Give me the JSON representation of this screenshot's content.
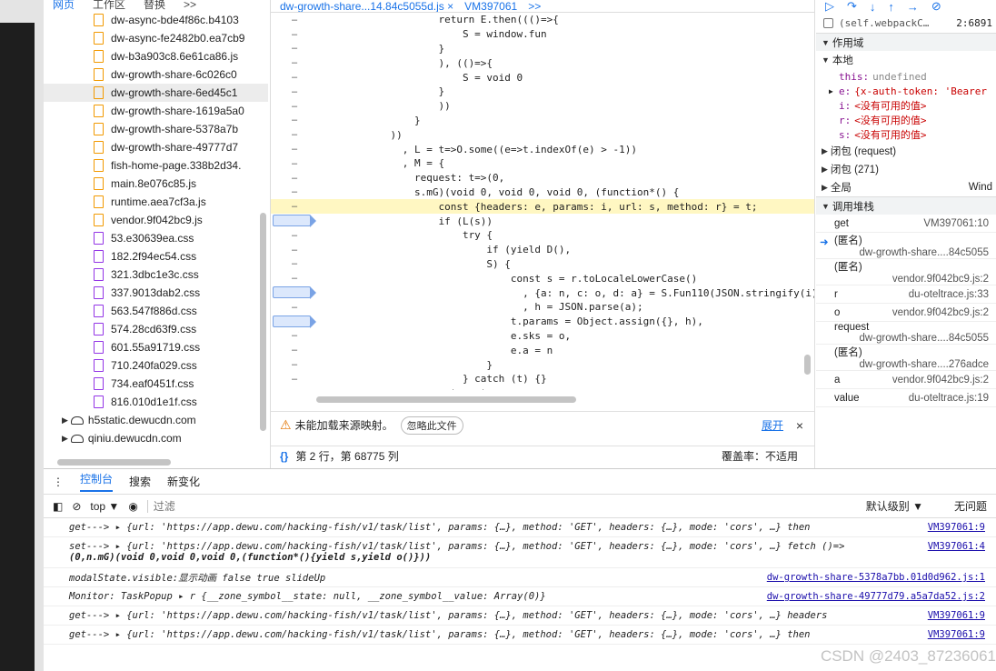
{
  "nav_tabs": [
    "网页",
    "工作区",
    "替换",
    ">>"
  ],
  "files": [
    {
      "name": "dw-async-bde4f86c.b4103",
      "type": "js"
    },
    {
      "name": "dw-async-fe2482b0.ea7cb9",
      "type": "js"
    },
    {
      "name": "dw-b3a903c8.6e61ca86.js",
      "type": "js"
    },
    {
      "name": "dw-growth-share-6c026c0",
      "type": "js"
    },
    {
      "name": "dw-growth-share-6ed45c1",
      "type": "js",
      "selected": true
    },
    {
      "name": "dw-growth-share-1619a5a0",
      "type": "js"
    },
    {
      "name": "dw-growth-share-5378a7b",
      "type": "js"
    },
    {
      "name": "dw-growth-share-49777d7",
      "type": "js"
    },
    {
      "name": "fish-home-page.338b2d34.",
      "type": "js"
    },
    {
      "name": "main.8e076c85.js",
      "type": "js"
    },
    {
      "name": "runtime.aea7cf3a.js",
      "type": "js"
    },
    {
      "name": "vendor.9f042bc9.js",
      "type": "js"
    },
    {
      "name": "53.e30639ea.css",
      "type": "css"
    },
    {
      "name": "182.2f94ec54.css",
      "type": "css"
    },
    {
      "name": "321.3dbc1e3c.css",
      "type": "css"
    },
    {
      "name": "337.9013dab2.css",
      "type": "css"
    },
    {
      "name": "563.547f886d.css",
      "type": "css"
    },
    {
      "name": "574.28cd63f9.css",
      "type": "css"
    },
    {
      "name": "601.55a91719.css",
      "type": "css"
    },
    {
      "name": "710.240fa029.css",
      "type": "css"
    },
    {
      "name": "734.eaf0451f.css",
      "type": "css"
    },
    {
      "name": "816.010d1e1f.css",
      "type": "css"
    }
  ],
  "domains": [
    "h5static.dewucdn.com",
    "qiniu.dewucdn.com"
  ],
  "editor": {
    "tab_label": "dw-growth-share...14.84c5055d.js",
    "tab_close": "×",
    "tab2": "VM397061",
    "more": ">>",
    "lines": [
      {
        "g": "–",
        "t": "                    return E.then((()=>{",
        "bp": false,
        "hl": false
      },
      {
        "g": "–",
        "t": "                        S = window.fun",
        "bp": false,
        "hl": false
      },
      {
        "g": "–",
        "t": "                    }",
        "bp": false,
        "hl": false
      },
      {
        "g": "–",
        "t": "                    ), (()=>{",
        "bp": false,
        "hl": false
      },
      {
        "g": "–",
        "t": "                        S = void 0",
        "bp": false,
        "hl": false
      },
      {
        "g": "–",
        "t": "                    }",
        "bp": false,
        "hl": false
      },
      {
        "g": "–",
        "t": "                    ))",
        "bp": false,
        "hl": false
      },
      {
        "g": "–",
        "t": "                }",
        "bp": false,
        "hl": false
      },
      {
        "g": "–",
        "t": "            ))",
        "bp": false,
        "hl": false
      },
      {
        "g": "–",
        "t": "              , L = t=>O.some((e=>t.indexOf(e) > -1))",
        "bp": false,
        "hl": false
      },
      {
        "g": "–",
        "t": "              , M = {",
        "bp": false,
        "hl": false
      },
      {
        "g": "–",
        "t": "                request: t=>(0,",
        "bp": false,
        "hl": false
      },
      {
        "g": "–",
        "t": "                s.mG)(void 0, void 0, void 0, (function*() {",
        "bp": false,
        "hl": false
      },
      {
        "g": "–",
        "t": "                    const {headers: e, params: i, url: s, method: r} = t;",
        "bp": false,
        "hl": true
      },
      {
        "g": "",
        "t": "                    if (L(s))",
        "bp": true,
        "hl": false
      },
      {
        "g": "–",
        "t": "                        try {",
        "bp": false,
        "hl": false
      },
      {
        "g": "–",
        "t": "                            if (yield D(),",
        "bp": false,
        "hl": false
      },
      {
        "g": "–",
        "t": "                            S) {",
        "bp": false,
        "hl": false
      },
      {
        "g": "–",
        "t": "                                const s = r.toLocaleLowerCase()",
        "bp": false,
        "hl": false
      },
      {
        "g": "",
        "t": "                                  , {a: n, c: o, d: a} = S.Fun110(JSON.stringify(i)",
        "bp": true,
        "hl": false
      },
      {
        "g": "–",
        "t": "                                  , h = JSON.parse(a);",
        "bp": false,
        "hl": false
      },
      {
        "g": "",
        "t": "                                t.params = Object.assign({}, h),",
        "bp": true,
        "hl": false
      },
      {
        "g": "–",
        "t": "                                e.sks = o,",
        "bp": false,
        "hl": false
      },
      {
        "g": "–",
        "t": "                                e.a = n",
        "bp": false,
        "hl": false
      },
      {
        "g": "–",
        "t": "                            }",
        "bp": false,
        "hl": false
      },
      {
        "g": "–",
        "t": "                        } catch (t) {}",
        "bp": false,
        "hl": false
      },
      {
        "g": "–",
        "t": "                    return t",
        "bp": false,
        "hl": false
      }
    ],
    "warning": "未能加载来源映射。",
    "ignore_file": "忽略此文件",
    "expand": "展开",
    "close": "×",
    "braces": "{}",
    "cursor_pos": "第 2 行，第 68775 列",
    "coverage": "覆盖率：不适用"
  },
  "right_panel": {
    "toolbar_icons": [
      "resume-icon",
      "step-over-icon",
      "step-into-icon",
      "step-out-icon",
      "step-icon",
      "deactivate-icon"
    ],
    "webpack_label": "(self.webpackC…",
    "webpack_val": "2:6891",
    "scope_header": "作用域",
    "local_header": "本地",
    "props": [
      {
        "name": "this:",
        "val": "undefined",
        "gray": true
      },
      {
        "name": "e:",
        "val": "{x-auth-token: 'Bearer",
        "gray": false,
        "expandable": true
      },
      {
        "name": "i:",
        "val": "<没有可用的值>",
        "gray": false
      },
      {
        "name": "r:",
        "val": "<没有可用的值>",
        "gray": false
      },
      {
        "name": "s:",
        "val": "<没有可用的值>",
        "gray": false
      }
    ],
    "closures": [
      "闭包 (request)",
      "闭包 (271)"
    ],
    "global_label": "全局",
    "global_val": "Wind",
    "callstack_header": "调用堆栈",
    "stack": [
      {
        "fn": "get",
        "loc": "VM397061:10",
        "inline": true,
        "current": false
      },
      {
        "fn": "(匿名)",
        "loc": "dw-growth-share....84c5055",
        "inline": false,
        "current": true
      },
      {
        "fn": "(匿名)",
        "loc": "vendor.9f042bc9.js:2",
        "inline": false,
        "current": false
      },
      {
        "fn": "r",
        "loc": "du-oteltrace.js:33",
        "inline": true,
        "current": false
      },
      {
        "fn": "o",
        "loc": "vendor.9f042bc9.js:2",
        "inline": true,
        "current": false
      },
      {
        "fn": "request",
        "loc": "dw-growth-share....84c5055",
        "inline": false,
        "current": false
      },
      {
        "fn": "(匿名)",
        "loc": "dw-growth-share....276adce",
        "inline": false,
        "current": false
      },
      {
        "fn": "a",
        "loc": "vendor.9f042bc9.js:2",
        "inline": true,
        "current": false
      },
      {
        "fn": "value",
        "loc": "du-oteltrace.js:19",
        "inline": true,
        "current": false
      }
    ]
  },
  "console": {
    "tabs": [
      "控制台",
      "搜索",
      "新变化"
    ],
    "context": "top ▼",
    "filter_placeholder": "过滤",
    "level": "默认级别 ▼",
    "issues": "无问题",
    "rows": [
      {
        "text": "get---> ▸ {url: 'https://app.dewu.com/hacking-fish/v1/task/list', params: {…}, method: 'GET', headers: {…}, mode: 'cors', …} then",
        "extra": "",
        "src": "VM397061:9"
      },
      {
        "text": "set---> ▸ {url: 'https://app.dewu.com/hacking-fish/v1/task/list', params: {…}, method: 'GET', headers: {…}, mode: 'cors', …} fetch ()=>",
        "extra": "(0,n.mG)(void 0,void 0,void 0,(function*(){yield s,yield o()}))",
        "src": "VM397061:4"
      },
      {
        "text": "modalState.visible:显示动画 false true slideUp",
        "extra": "",
        "src": "dw-growth-share-5378a7bb.01d0d962.js:1"
      },
      {
        "text": "Monitor: TaskPopup ▸ r {__zone_symbol__state: null, __zone_symbol__value: Array(0)}",
        "extra": "",
        "src": "dw-growth-share-49777d79.a5a7da52.js:2"
      },
      {
        "text": "get---> ▸ {url: 'https://app.dewu.com/hacking-fish/v1/task/list', params: {…}, method: 'GET', headers: {…}, mode: 'cors', …} headers",
        "extra": "",
        "src": "VM397061:9"
      },
      {
        "text": "get---> ▸ {url: 'https://app.dewu.com/hacking-fish/v1/task/list', params: {…}, method: 'GET', headers: {…}, mode: 'cors', …} then",
        "extra": "",
        "src": "VM397061:9"
      }
    ],
    "watermark": "CSDN @2403_87236061"
  }
}
